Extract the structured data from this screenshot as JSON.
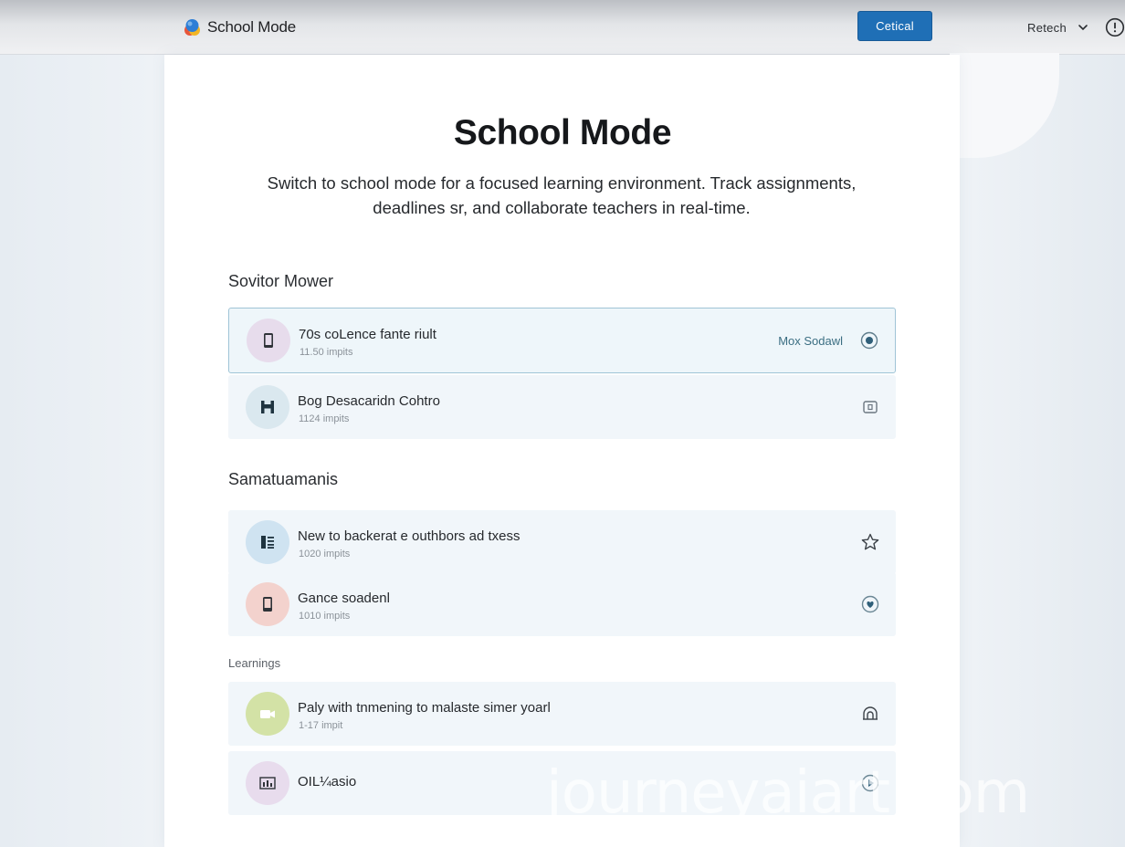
{
  "app": {
    "name": "School Mode",
    "logo_icon": "app-logo-icon"
  },
  "topbar": {
    "primary_button_label": "Cetical",
    "account_label": "Retech",
    "info_icon": "info-icon"
  },
  "hero": {
    "title": "School Mode",
    "description": "Switch to school mode for a focused learning environment. Track assignments, deadlines sr, and collaborate teachers in real-time."
  },
  "sections": [
    {
      "label": "Sovitor Mower",
      "items": [
        {
          "title": "70s coLence fante riult",
          "subtitle": "11.50 impits",
          "tag": "Mox Sodawl",
          "icon": "phone-icon",
          "action_icon": "radio-icon",
          "selected": true,
          "accent": "#e7dcec"
        },
        {
          "title": "Bog Desacaridn Cohtro",
          "subtitle": "1124 impits",
          "icon": "sign-icon",
          "action_icon": "square-icon",
          "accent": "#dae8ef"
        }
      ]
    },
    {
      "label": "Samatuamanis",
      "items": [
        {
          "title": "New to backerat e outhbors ad txess",
          "subtitle": "1020 impits",
          "icon": "list-icon",
          "action_icon": "star-icon",
          "accent": "#cfe3f1"
        },
        {
          "title": "Gance soadenl",
          "subtitle": "1010 impits",
          "icon": "tablet-icon",
          "action_icon": "heart-icon",
          "accent": "#f3d2cd"
        }
      ]
    },
    {
      "label": "Learnings",
      "items": [
        {
          "title": "Paly with tnmening to malaste simer yoarl",
          "subtitle": "1-17 impit",
          "icon": "video-icon",
          "action_icon": "bell-icon",
          "accent": "#d3e2a6"
        },
        {
          "title": "OIL¼asio",
          "subtitle": "",
          "icon": "chart-icon",
          "action_icon": "play-icon",
          "accent": "#e8dced"
        }
      ]
    }
  ],
  "watermark": "journeyaiart.com"
}
